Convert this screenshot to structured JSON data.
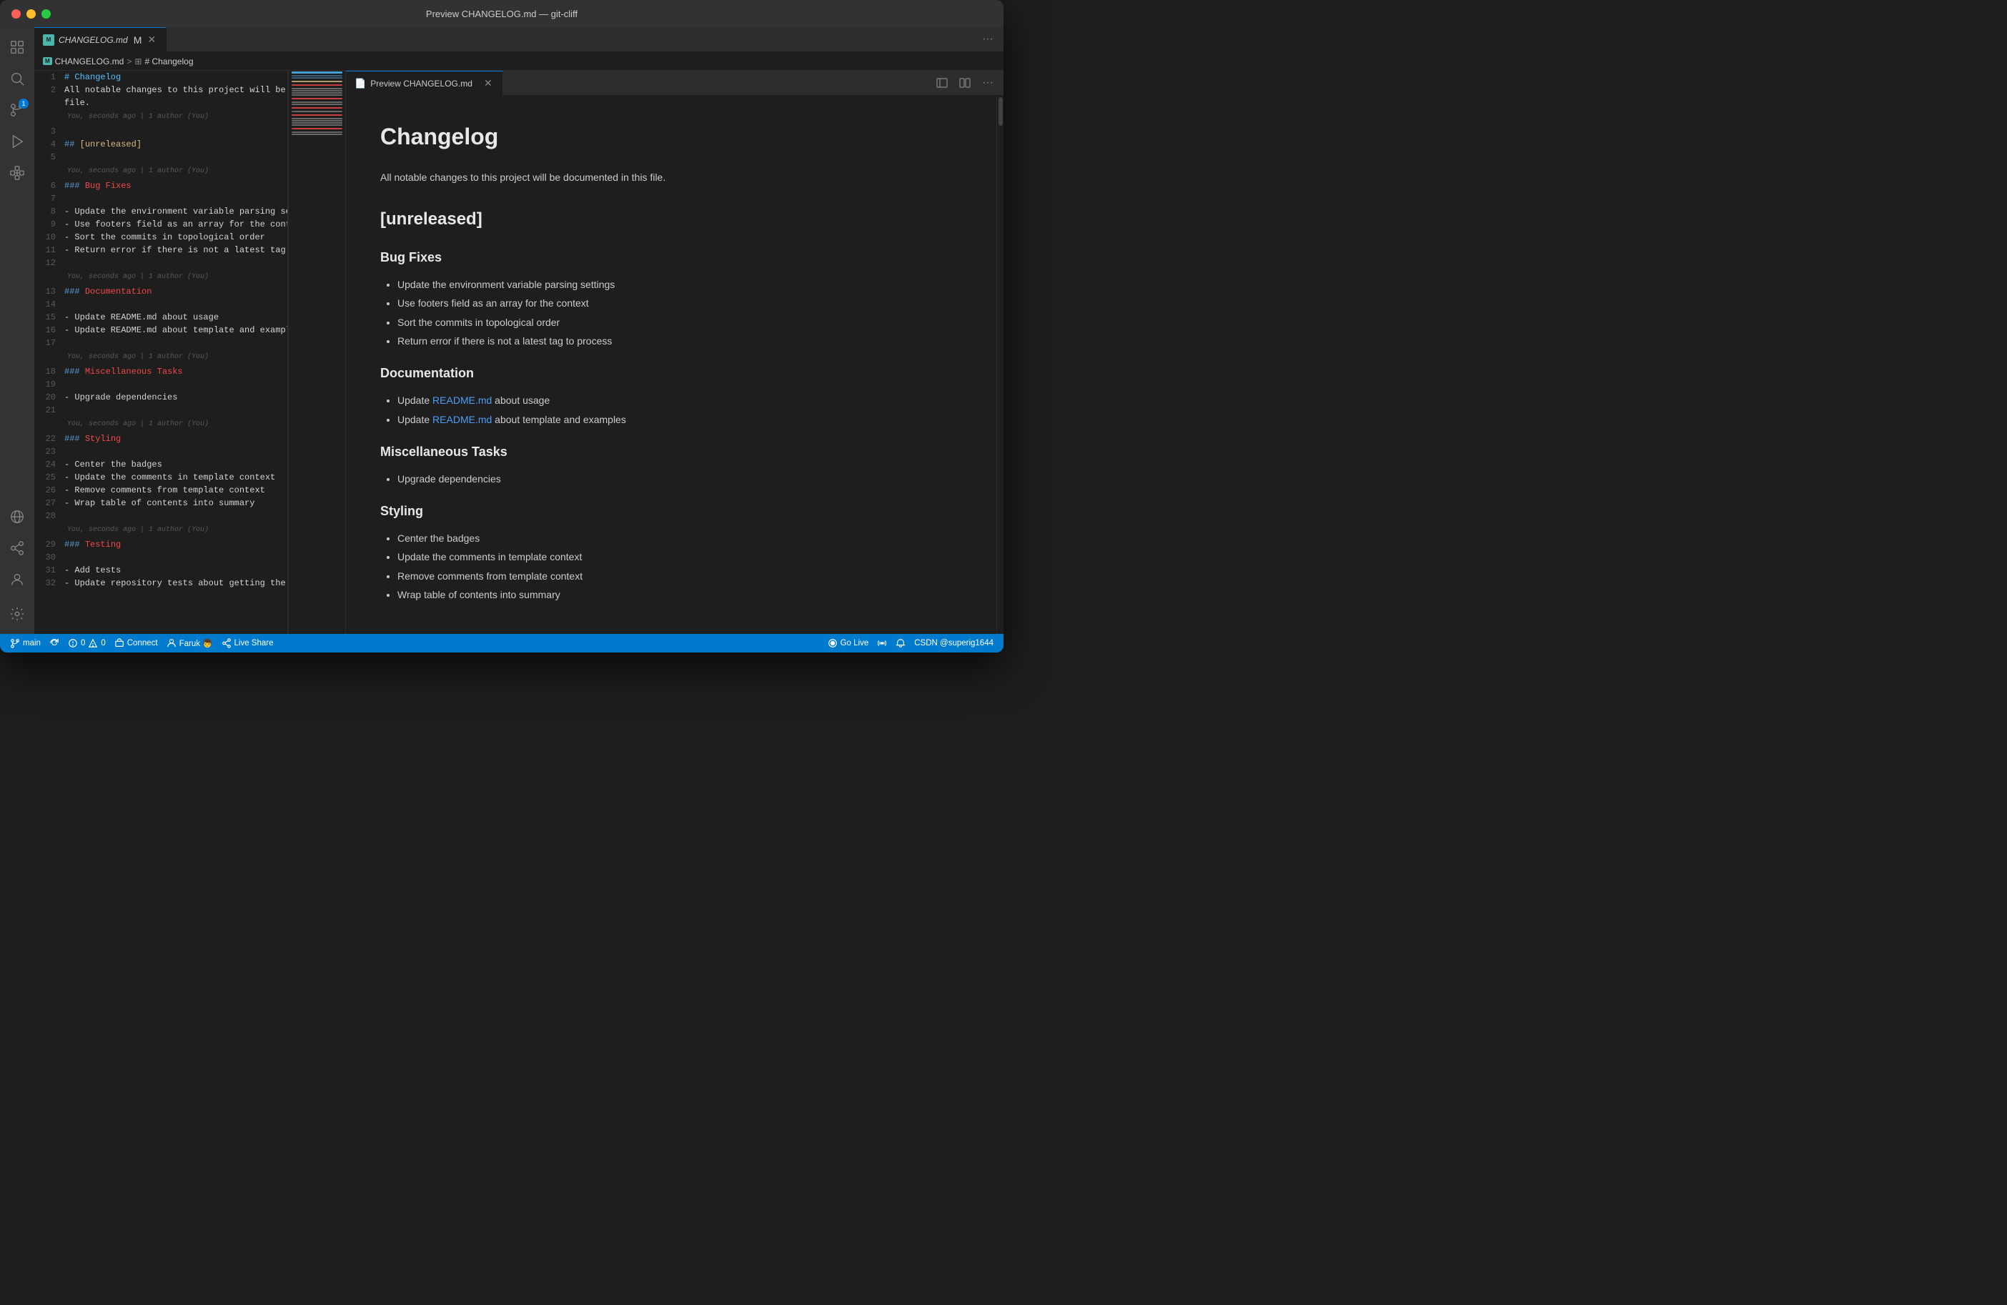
{
  "window": {
    "title": "Preview CHANGELOG.md — git-cliff"
  },
  "titlebar": {
    "title": "Preview CHANGELOG.md — git-cliff"
  },
  "tabs": {
    "left": [
      {
        "id": "changelog-md",
        "label": "CHANGELOG.md",
        "icon": "M",
        "modified": true,
        "active": true
      },
      {
        "id": "preview-changelog",
        "label": "Preview CHANGELOG.md",
        "icon": "P",
        "active": false,
        "close": true
      }
    ]
  },
  "breadcrumb": {
    "items": [
      "CHANGELOG.md",
      "# Changelog"
    ]
  },
  "editor": {
    "lines": [
      {
        "num": 1,
        "content": "# Changelog",
        "type": "heading1"
      },
      {
        "num": 2,
        "content": "All notable changes to this project will be documented in this",
        "type": "normal"
      },
      {
        "num": "",
        "content": "file.",
        "type": "normal"
      },
      {
        "num": 3,
        "content": "",
        "type": "empty"
      },
      {
        "num": 4,
        "content": "## [unreleased]",
        "type": "heading2-unreleased"
      },
      {
        "num": 5,
        "content": "",
        "type": "empty"
      },
      {
        "num": 6,
        "content": "### Bug Fixes",
        "type": "heading3-red"
      },
      {
        "num": 7,
        "content": "",
        "type": "empty"
      },
      {
        "num": 8,
        "content": "- Update the environment variable parsing settings",
        "type": "list"
      },
      {
        "num": 9,
        "content": "- Use footers field as an array for the context",
        "type": "list"
      },
      {
        "num": 10,
        "content": "- Sort the commits in topological order",
        "type": "list"
      },
      {
        "num": 11,
        "content": "- Return error if there is not a latest tag to process",
        "type": "list"
      },
      {
        "num": 12,
        "content": "",
        "type": "empty"
      },
      {
        "num": 13,
        "content": "### Documentation",
        "type": "heading3-red"
      },
      {
        "num": 14,
        "content": "",
        "type": "empty"
      },
      {
        "num": 15,
        "content": "- Update README.md about usage",
        "type": "list"
      },
      {
        "num": 16,
        "content": "- Update README.md about template and examples",
        "type": "list"
      },
      {
        "num": 17,
        "content": "",
        "type": "empty"
      },
      {
        "num": 18,
        "content": "### Miscellaneous Tasks",
        "type": "heading3-red"
      },
      {
        "num": 19,
        "content": "",
        "type": "empty"
      },
      {
        "num": 20,
        "content": "- Upgrade dependencies",
        "type": "list"
      },
      {
        "num": 21,
        "content": "",
        "type": "empty"
      },
      {
        "num": 22,
        "content": "### Styling",
        "type": "heading3-red"
      },
      {
        "num": 23,
        "content": "",
        "type": "empty"
      },
      {
        "num": 24,
        "content": "- Center the badges",
        "type": "list"
      },
      {
        "num": 25,
        "content": "- Update the comments in template context",
        "type": "list"
      },
      {
        "num": 26,
        "content": "- Remove comments from template context",
        "type": "list"
      },
      {
        "num": 27,
        "content": "- Wrap table of contents into summary",
        "type": "list"
      },
      {
        "num": 28,
        "content": "",
        "type": "empty"
      },
      {
        "num": 29,
        "content": "### Testing",
        "type": "heading3-red"
      },
      {
        "num": 30,
        "content": "",
        "type": "empty"
      },
      {
        "num": 31,
        "content": "- Add tests",
        "type": "list"
      },
      {
        "num": 32,
        "content": "- Update repository tests about getting the latest tag",
        "type": "list"
      }
    ],
    "blameInfo": "You, seconds ago | 1 author (You)"
  },
  "preview": {
    "title": "Changelog",
    "intro": "All notable changes to this project will be documented in this file.",
    "sections": [
      {
        "heading": "[unreleased]",
        "level": "h2",
        "subsections": [
          {
            "heading": "Bug Fixes",
            "level": "h3",
            "items": [
              "Update the environment variable parsing settings",
              "Use footers field as an array for the context",
              "Sort the commits in topological order",
              "Return error if there is not a latest tag to process"
            ]
          },
          {
            "heading": "Documentation",
            "level": "h3",
            "items": [
              {
                "text": "Update README.md about usage",
                "link": "README.md",
                "linkText": "README.md",
                "prefix": "Update ",
                "suffix": " about usage"
              },
              {
                "text": "Update README.md about template and examples",
                "link": "README.md",
                "linkText": "README.md",
                "prefix": "Update ",
                "suffix": " about template and examples"
              }
            ],
            "hasLinks": true
          },
          {
            "heading": "Miscellaneous Tasks",
            "level": "h3",
            "items": [
              "Upgrade dependencies"
            ]
          },
          {
            "heading": "Styling",
            "level": "h3",
            "items": [
              "Center the badges",
              "Update the comments in template context",
              "Remove comments from template context",
              "Wrap table of contents into summary"
            ]
          }
        ]
      }
    ]
  },
  "statusbar": {
    "branch": "main",
    "sync": "",
    "errors": "0",
    "warnings": "0",
    "connect": "Connect",
    "author": "Faruk 👦",
    "liveshare": "Live Share",
    "golive": "Go Live",
    "username": "CSDN @superig1644",
    "notification": ""
  },
  "activitybar": {
    "icons": [
      {
        "id": "explorer",
        "symbol": "⊞",
        "active": false
      },
      {
        "id": "search",
        "symbol": "⌕",
        "active": false
      },
      {
        "id": "source-control",
        "symbol": "⑂",
        "active": false,
        "badge": "1"
      },
      {
        "id": "run",
        "symbol": "▶",
        "active": false
      },
      {
        "id": "extensions",
        "symbol": "⊞",
        "active": false
      },
      {
        "id": "remote-explorer",
        "symbol": "⊡",
        "active": false
      },
      {
        "id": "share",
        "symbol": "⑂",
        "active": false
      }
    ]
  }
}
